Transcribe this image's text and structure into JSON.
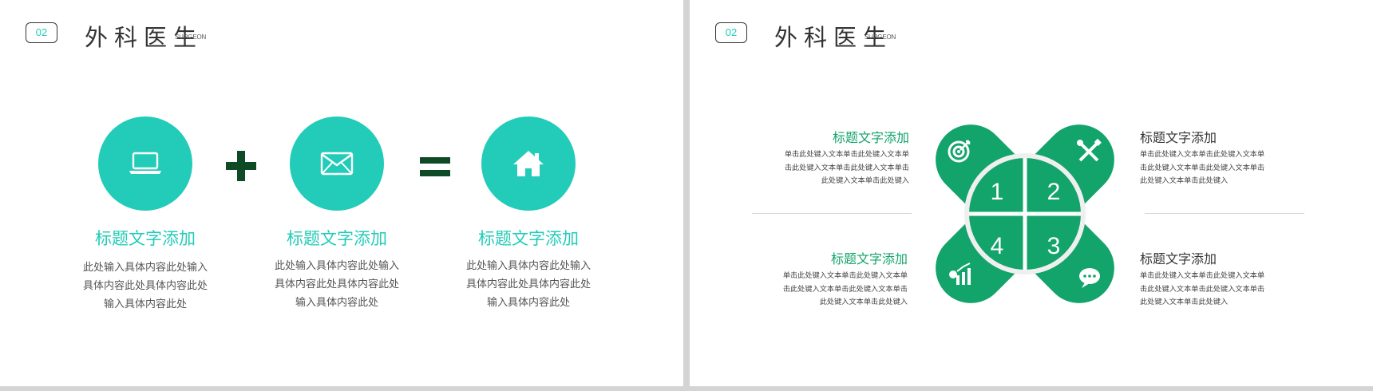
{
  "header": {
    "number": "02",
    "title": "外科医生",
    "subtitle": "SURGEON"
  },
  "colors": {
    "teal": "#22ccb8",
    "green": "#12a46a",
    "dark_green": "#0f4a27",
    "text": "#444444",
    "line": "#d8d8d8"
  },
  "slide1": {
    "operators": {
      "plus": "+",
      "equals": "="
    },
    "items": [
      {
        "icon": "laptop-icon",
        "title": "标题文字添加",
        "lines": [
          "此处输入具体内容此处输入",
          "具体内容此处具体内容此处",
          "输入具体内容此处"
        ]
      },
      {
        "icon": "envelope-icon",
        "title": "标题文字添加",
        "lines": [
          "此处输入具体内容此处输入",
          "具体内容此处具体内容此处",
          "输入具体内容此处"
        ]
      },
      {
        "icon": "house-icon",
        "title": "标题文字添加",
        "lines": [
          "此处输入具体内容此处输入",
          "具体内容此处具体内容此处",
          "输入具体内容此处"
        ]
      }
    ]
  },
  "slide2": {
    "quadrants": [
      "1",
      "2",
      "3",
      "4"
    ],
    "icons": [
      "target-icon",
      "tools-icon",
      "chat-bubble-icon",
      "growth-chart-icon"
    ],
    "blocks": [
      {
        "title": "标题文字添加",
        "lines": [
          "单击此处键入文本单击此处键入文本单",
          "击此处键入文本单击此处键入文本单击",
          "此处键入文本单击此处键入"
        ]
      },
      {
        "title": "标题文字添加",
        "lines": [
          "单击此处键入文本单击此处键入文本单",
          "击此处键入文本单击此处键入文本单击",
          "此处键入文本单击此处键入"
        ]
      },
      {
        "title": "标题文字添加",
        "lines": [
          "单击此处键入文本单击此处键入文本单",
          "击此处键入文本单击此处键入文本单击",
          "此处键入文本单击此处键入"
        ]
      },
      {
        "title": "标题文字添加",
        "lines": [
          "单击此处键入文本单击此处键入文本单",
          "击此处键入文本单击此处键入文本单击",
          "此处键入文本单击此处键入"
        ]
      }
    ]
  }
}
